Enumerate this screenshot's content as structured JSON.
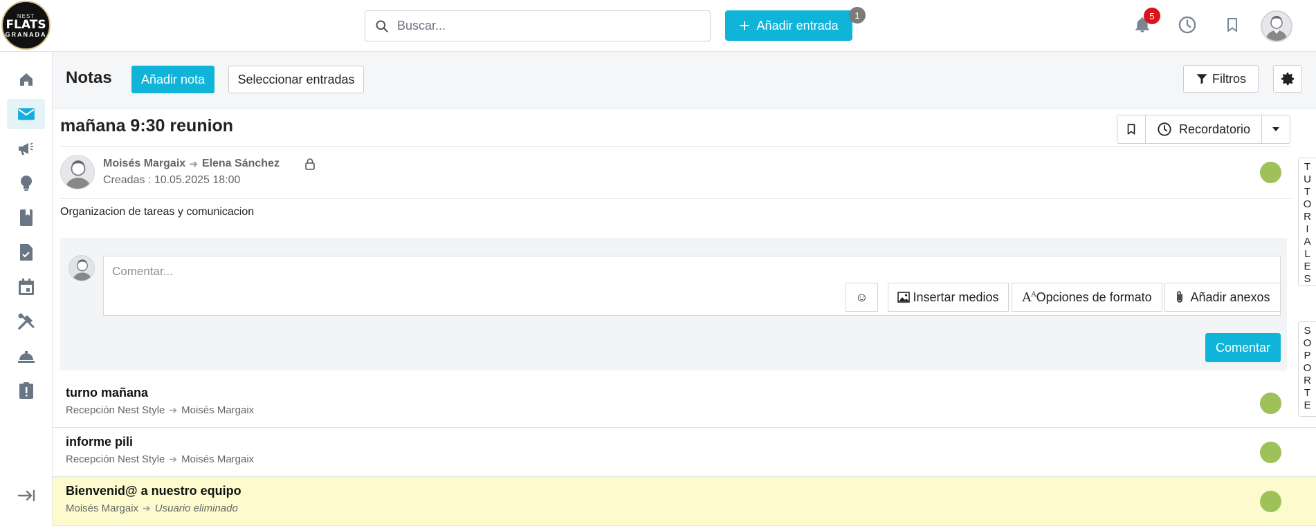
{
  "header": {
    "logo": {
      "line1": "NEST",
      "line2": "FLATS",
      "line3": "GRANADA"
    },
    "search_placeholder": "Buscar...",
    "add_entry_label": "Añadir entrada",
    "add_entry_badge": "1",
    "notifications_badge": "5",
    "icons": [
      "search-icon",
      "plus-icon",
      "bell-icon",
      "clock-icon",
      "bookmark-icon",
      "avatar"
    ]
  },
  "sidebar": {
    "items": [
      {
        "name": "home",
        "icon": "home-icon",
        "active": false
      },
      {
        "name": "mail",
        "icon": "mail-icon",
        "active": true
      },
      {
        "name": "announcements",
        "icon": "megaphone-icon",
        "active": false
      },
      {
        "name": "ideas",
        "icon": "lightbulb-icon",
        "active": false
      },
      {
        "name": "book",
        "icon": "book-icon",
        "active": false
      },
      {
        "name": "tasks",
        "icon": "file-check-icon",
        "active": false
      },
      {
        "name": "calendar",
        "icon": "calendar-icon",
        "active": false
      },
      {
        "name": "tools",
        "icon": "tools-icon",
        "active": false
      },
      {
        "name": "service",
        "icon": "service-bell-icon",
        "active": false
      },
      {
        "name": "alerts",
        "icon": "clipboard-alert-icon",
        "active": false
      },
      {
        "name": "logout",
        "icon": "logout-arrow-icon",
        "active": false
      }
    ]
  },
  "notes_header": {
    "title": "Notas",
    "add_note_label": "Añadir nota",
    "select_entries_label": "Seleccionar entradas",
    "filters_label": "Filtros"
  },
  "note": {
    "title": "mañana 9:30 reunion",
    "reminder_label": "Recordatorio",
    "author": "Moisés Margaix",
    "recipient": "Elena Sánchez",
    "created": "Creadas : 10.05.2025 18:00",
    "body": "Organizacion de tareas y comunicacion",
    "status_color": "#9ec15a"
  },
  "comment": {
    "placeholder": "Comentar...",
    "emoji": "☺",
    "insert_media_label": "Insertar medios",
    "format_options_label": "Opciones de formato",
    "attachments_label": "Añadir anexos",
    "submit_label": "Comentar"
  },
  "list": [
    {
      "title": "turno mañana",
      "from": "Recepción Nest Style",
      "to": "Moisés Margaix",
      "to_italic": false,
      "highlight": false
    },
    {
      "title": "informe pili",
      "from": "Recepción Nest Style",
      "to": "Moisés Margaix",
      "to_italic": false,
      "highlight": false
    },
    {
      "title": "Bienvenid@ a nuestro equipo",
      "from": "Moisés Margaix",
      "to": "Usuario eliminado",
      "to_italic": true,
      "highlight": true
    }
  ],
  "side_tabs": {
    "tutorials": "TUTORIALES",
    "support": "SOPORTE"
  },
  "colors": {
    "accent": "#0fb4d8",
    "status_green": "#9ec15a",
    "badge_red": "#d9141c",
    "highlight_row": "#fdfbce"
  }
}
